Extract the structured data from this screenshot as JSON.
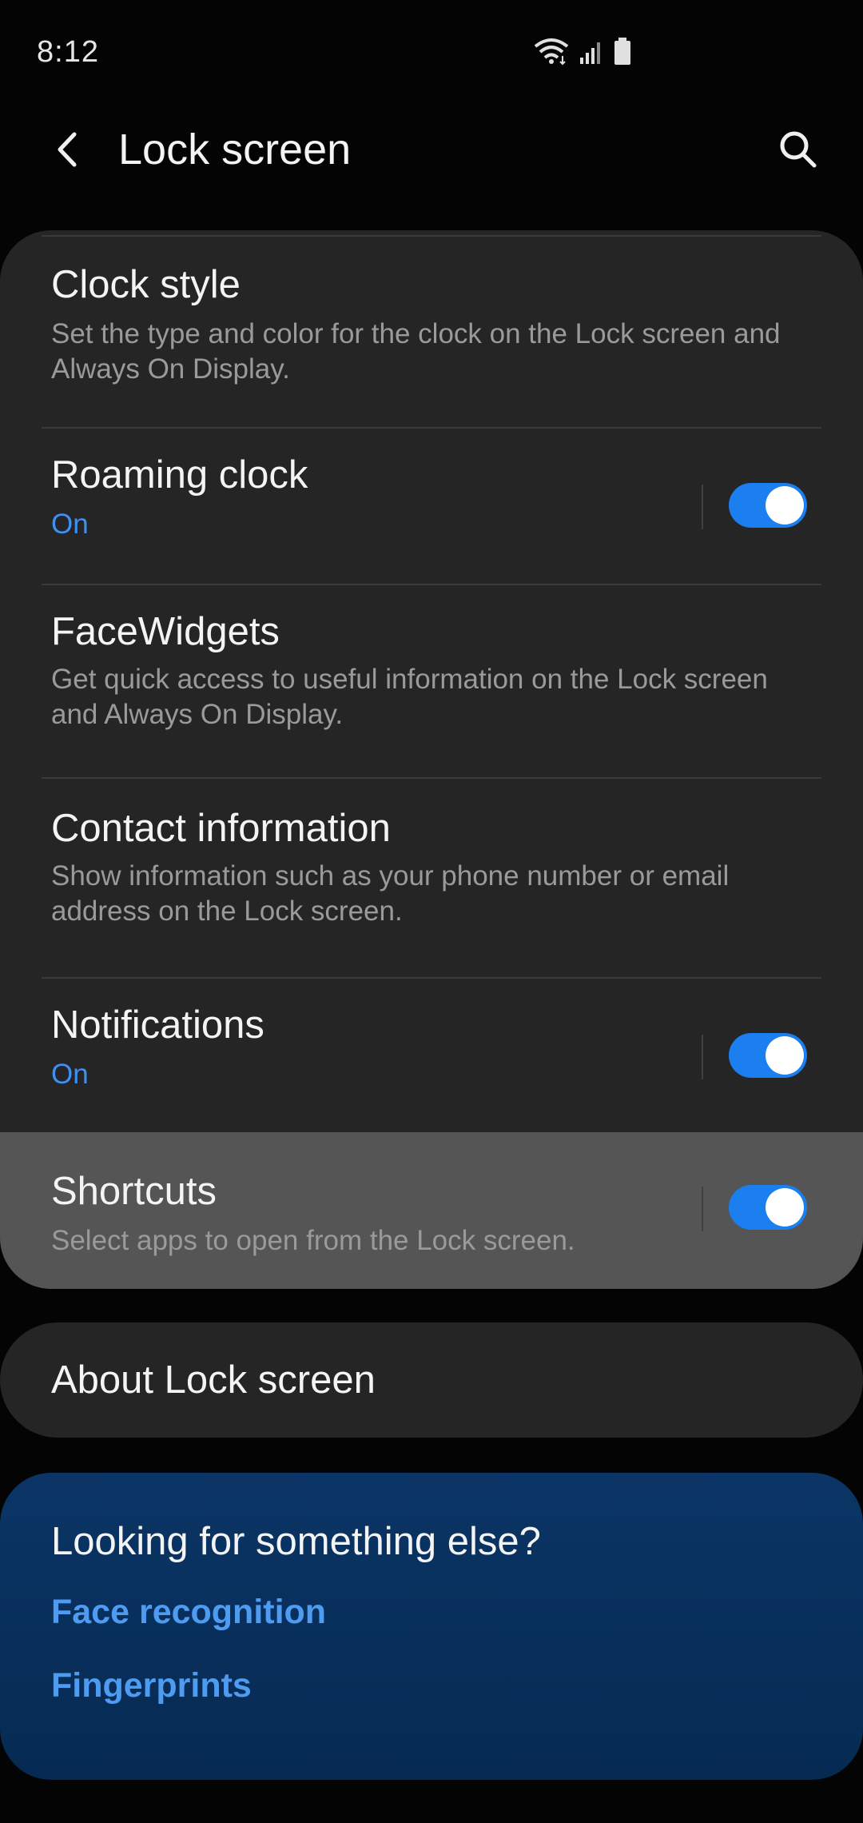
{
  "status_bar": {
    "time": "8:12",
    "icons": [
      "wifi-icon",
      "signal-icon",
      "battery-icon"
    ]
  },
  "app_bar": {
    "title": "Lock screen",
    "back_icon": "back-arrow-icon",
    "search_icon": "search-icon"
  },
  "settings": {
    "clock_style": {
      "title": "Clock style",
      "subtitle": "Set the type and color for the clock on the Lock screen and Always On Display."
    },
    "roaming_clock": {
      "title": "Roaming clock",
      "status": "On",
      "enabled": true
    },
    "facewidgets": {
      "title": "FaceWidgets",
      "subtitle": "Get quick access to useful information on the Lock screen and Always On Display."
    },
    "contact_information": {
      "title": "Contact information",
      "subtitle": "Show information such as your phone number or email address on the Lock screen."
    },
    "notifications": {
      "title": "Notifications",
      "status": "On",
      "enabled": true
    },
    "shortcuts": {
      "title": "Shortcuts",
      "subtitle": "Select apps to open from the Lock screen.",
      "enabled": true
    }
  },
  "about": {
    "label": "About Lock screen"
  },
  "suggestions": {
    "title": "Looking for something else?",
    "links": [
      "Face recognition",
      "Fingerprints"
    ]
  },
  "colors": {
    "background": "#040404",
    "card": "#252525",
    "highlight": "#555555",
    "accent": "#3e91f2",
    "toggle_on": "#1b7ff0",
    "suggest_card": "#0b3566"
  }
}
